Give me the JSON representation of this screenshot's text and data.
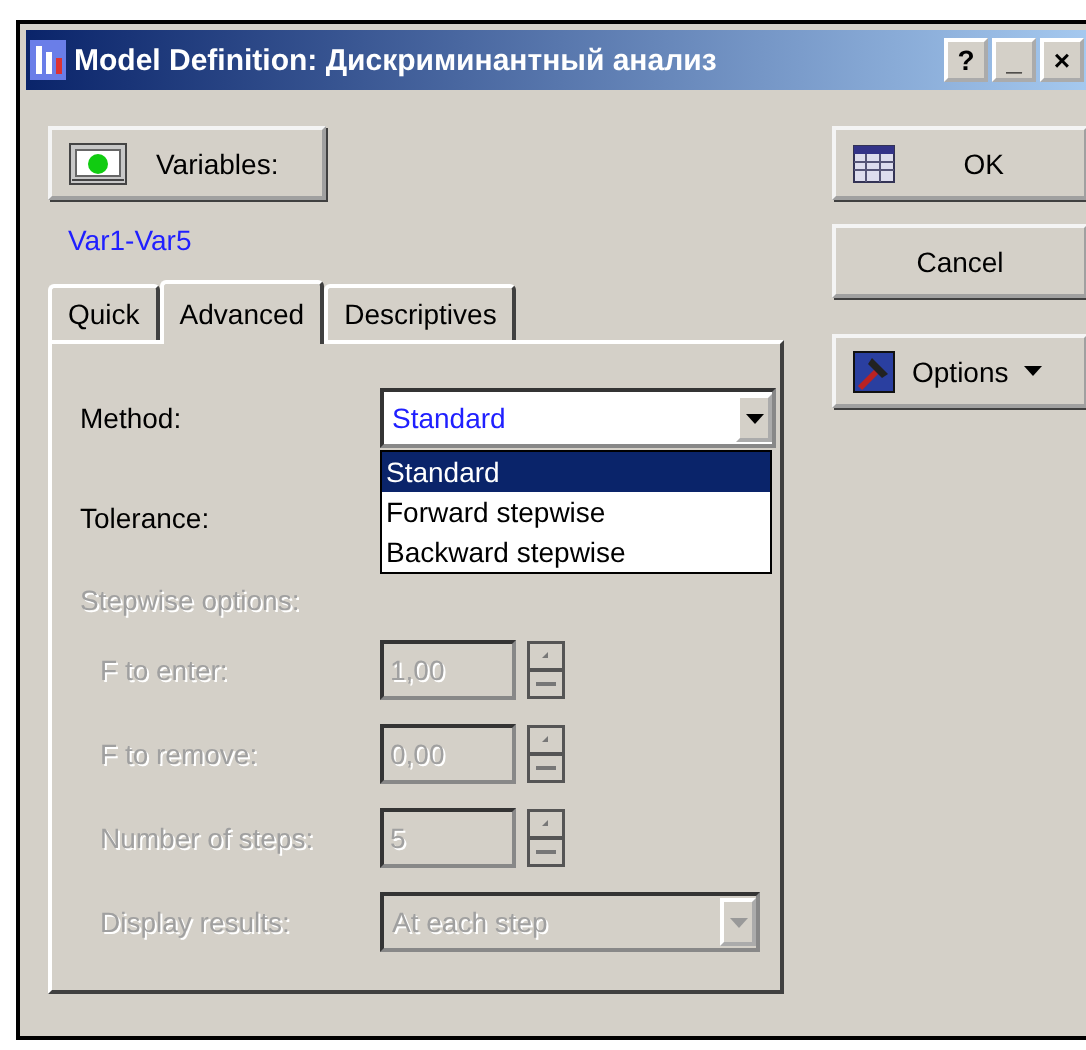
{
  "window": {
    "title": "Model Definition: Дискриминантный анализ",
    "controls": [
      "?",
      "_",
      "×"
    ]
  },
  "variables_button": {
    "label": "Variables:"
  },
  "variables_value": "Var1-Var5",
  "tabs": [
    {
      "label": "Quick",
      "selected": false
    },
    {
      "label": "Advanced",
      "selected": true
    },
    {
      "label": "Descriptives",
      "selected": false
    }
  ],
  "method": {
    "label": "Method:",
    "value": "Standard",
    "expanded": true,
    "options": [
      {
        "label": "Standard",
        "selected": true
      },
      {
        "label": "Forward stepwise",
        "selected": false
      },
      {
        "label": "Backward stepwise",
        "selected": false
      }
    ]
  },
  "tolerance": {
    "label": "Tolerance:"
  },
  "stepwise_options": {
    "label": "Stepwise options:",
    "disabled": true,
    "fields": [
      {
        "kind": "spin",
        "label": "F to enter:",
        "value": "1,00"
      },
      {
        "kind": "spin",
        "label": "F to remove:",
        "value": "0,00"
      },
      {
        "kind": "spin",
        "label": "Number of steps:",
        "value": "5"
      },
      {
        "kind": "combo",
        "label": "Display results:",
        "value": "At each step"
      }
    ]
  },
  "buttons": [
    {
      "kind": "ok",
      "label": "OK"
    },
    {
      "kind": "cancel",
      "label": "Cancel"
    },
    {
      "kind": "options",
      "label": "Options"
    }
  ]
}
